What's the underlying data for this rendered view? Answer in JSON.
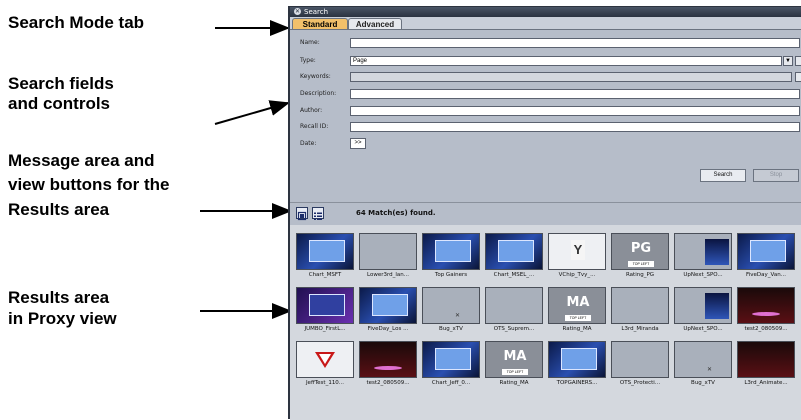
{
  "callouts": {
    "search_mode": "Search Mode tab",
    "search_fields_1": "Search fields",
    "search_fields_2": "and controls",
    "message_1": "Message area and",
    "message_2": "view buttons for the",
    "message_3": "Results area",
    "results_1": "Results area",
    "results_2": "in Proxy view"
  },
  "window": {
    "title": "Search",
    "tabs": [
      {
        "label": "Standard",
        "active": true
      },
      {
        "label": "Advanced",
        "active": false
      }
    ]
  },
  "form": {
    "name_label": "Name:",
    "name_value": "",
    "type_label": "Type:",
    "type_value": "Page",
    "keywords_label": "Keywords:",
    "description_label": "Description:",
    "author_label": "Author:",
    "recall_label": "Recall ID:",
    "date_label": "Date:",
    "date_button": ">>",
    "search_button": "Search",
    "stop_button": "Stop"
  },
  "message": {
    "text": "64 Match(es) found."
  },
  "results": [
    {
      "caption": "Chart_MSFT",
      "style": "blue-screen"
    },
    {
      "caption": "Lower3rd_lan...",
      "style": "grey"
    },
    {
      "caption": "Top Gainers",
      "style": "blue-screen"
    },
    {
      "caption": "Chart_MSEL_...",
      "style": "blue-screen"
    },
    {
      "caption": "VChip_Tvy_...",
      "style": "vchip"
    },
    {
      "caption": "Rating_PG",
      "style": "tv",
      "logo": "PG",
      "tag": "TOP LEFT"
    },
    {
      "caption": "UpNext_SPO...",
      "style": "panel"
    },
    {
      "caption": "FiveDay_Van...",
      "style": "blue-screen"
    },
    {
      "caption": "JUMBO_FirstL...",
      "style": "purple"
    },
    {
      "caption": "FiveDay_Los ...",
      "style": "blue-screen"
    },
    {
      "caption": "Bug_xTV",
      "style": "grey-x"
    },
    {
      "caption": "OTS_Suprem...",
      "style": "grey"
    },
    {
      "caption": "Rating_MA",
      "style": "tv",
      "logo": "MA",
      "tag": "TOP LEFT"
    },
    {
      "caption": "L3rd_Miranda",
      "style": "grey"
    },
    {
      "caption": "UpNext_SPO...",
      "style": "panel"
    },
    {
      "caption": "test2_080509...",
      "style": "dark-ellipse"
    },
    {
      "caption": "JeffTest_110...",
      "style": "vchip-red"
    },
    {
      "caption": "test2_080509...",
      "style": "dark-ellipse"
    },
    {
      "caption": "Chart_Jeff_0...",
      "style": "blue-screen"
    },
    {
      "caption": "Rating_MA",
      "style": "tv",
      "logo": "MA",
      "tag": "TOP LEFT"
    },
    {
      "caption": "TOPGAINERS...",
      "style": "blue-screen"
    },
    {
      "caption": "OTS_Protecti...",
      "style": "grey"
    },
    {
      "caption": "Bug_xTV",
      "style": "grey-x"
    },
    {
      "caption": "L3rd_Animate...",
      "style": "dark"
    }
  ]
}
